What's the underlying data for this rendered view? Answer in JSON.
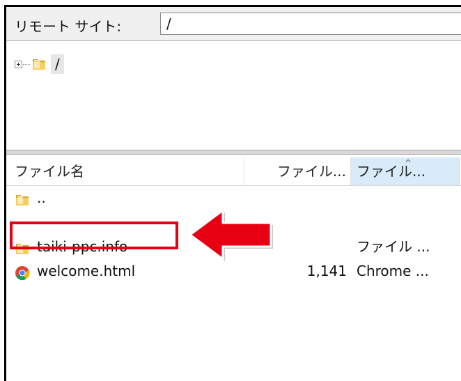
{
  "pathbar": {
    "label": "リモート サイト:",
    "path": "/"
  },
  "tree": {
    "root_label": "/"
  },
  "columns": {
    "name": "ファイル名",
    "size": "ファイル...",
    "type": "ファイル..."
  },
  "files": [
    {
      "name": "..",
      "size": "",
      "type": "",
      "icon": "folder-icon"
    },
    {
      "name": "taiki-ppc.info",
      "size": "",
      "type": "ファイル ...",
      "icon": "folder-icon"
    },
    {
      "name": "welcome.html",
      "size": "1,141",
      "type": "Chrome ...",
      "icon": "chrome-icon"
    }
  ],
  "colors": {
    "annotation": "#e60012",
    "selected_header": "#d9ebf9",
    "folder": "#e8b83a"
  }
}
